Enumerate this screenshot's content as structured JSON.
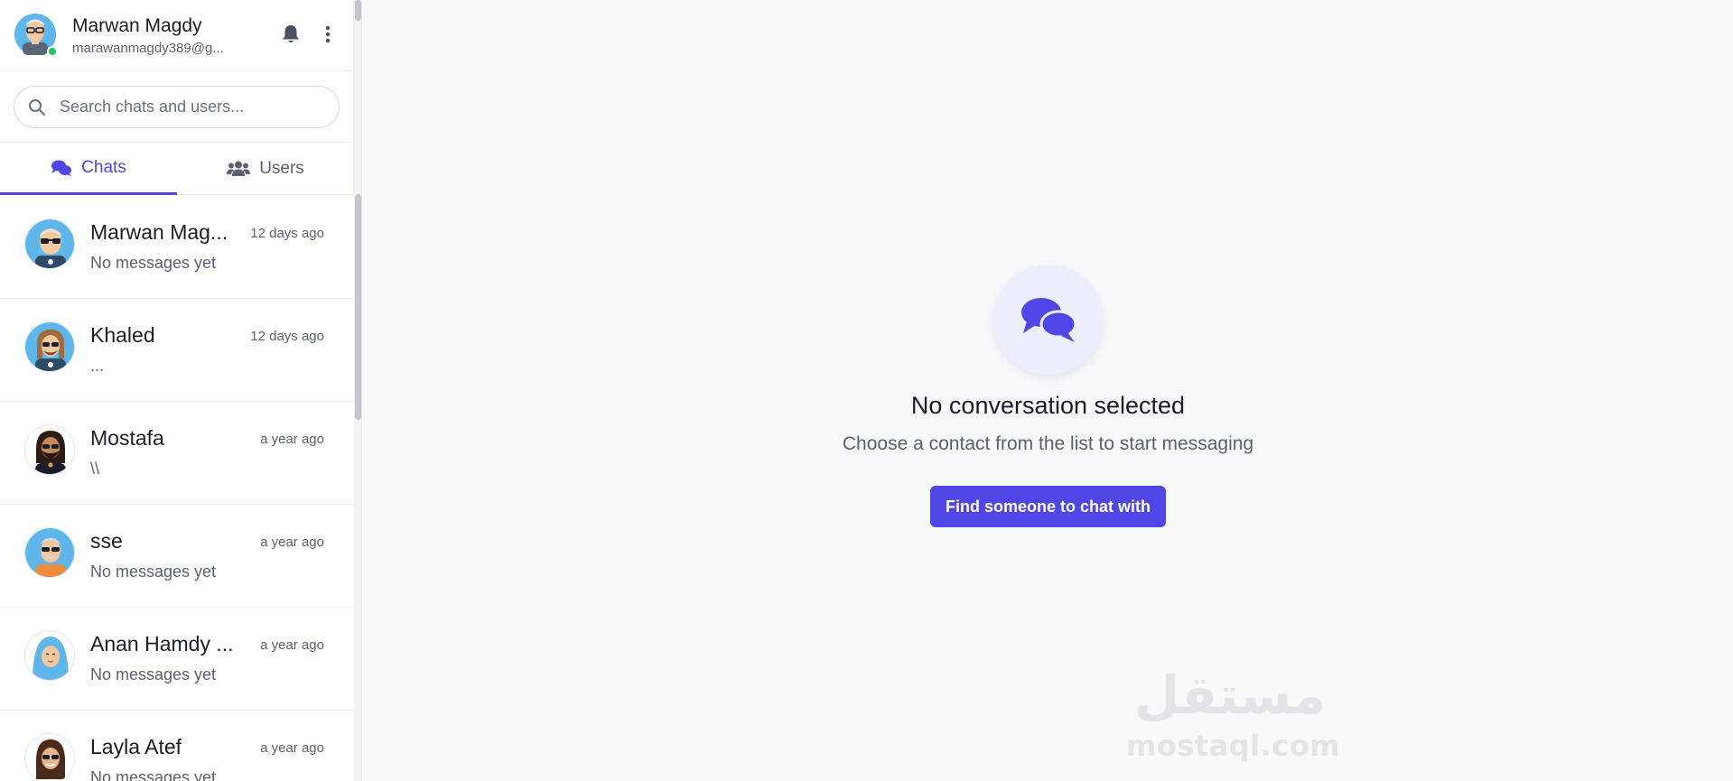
{
  "profile": {
    "name": "Marwan Magdy",
    "email": "marawanmagdy389@g...",
    "status_color": "#22c55e"
  },
  "header_icons": [
    "bell-icon",
    "kebab-menu-icon"
  ],
  "search": {
    "placeholder": "Search chats and users...",
    "value": ""
  },
  "tabs": [
    {
      "label": "Chats",
      "icon": "chats-icon",
      "active": true
    },
    {
      "label": "Users",
      "icon": "users-icon",
      "active": false
    }
  ],
  "chats": [
    {
      "name": "Marwan Mag...",
      "time": "12 days ago",
      "preview": "No messages yet",
      "avatar": "bald-man-sunglasses"
    },
    {
      "name": "Khaled",
      "time": "12 days ago",
      "preview": "...",
      "avatar": "long-hair-sunglasses"
    },
    {
      "name": "Mostafa",
      "time": "a year ago",
      "preview": "\\\\",
      "avatar": "bearded-man-sunglasses"
    },
    {
      "name": "sse",
      "time": "a year ago",
      "preview": "No messages yet",
      "avatar": "old-man-sunglasses"
    },
    {
      "name": "Anan Hamdy ...",
      "time": "a year ago",
      "preview": "No messages yet",
      "avatar": "woman-hijab"
    },
    {
      "name": "Layla Atef",
      "time": "a year ago",
      "preview": "No messages yet",
      "avatar": "woman-sunglasses"
    }
  ],
  "empty_state": {
    "icon": "chat-bubbles-icon",
    "title": "No conversation selected",
    "subtitle": "Choose a contact from the list to start messaging",
    "button_label": "Find someone to chat with"
  },
  "watermark": {
    "arabic": "مستقل",
    "latin": "mostaql.com"
  },
  "colors": {
    "accent": "#4f46e5",
    "background": "#f8f9fb",
    "sidebar": "#ffffff",
    "muted_text": "#5b6070"
  }
}
